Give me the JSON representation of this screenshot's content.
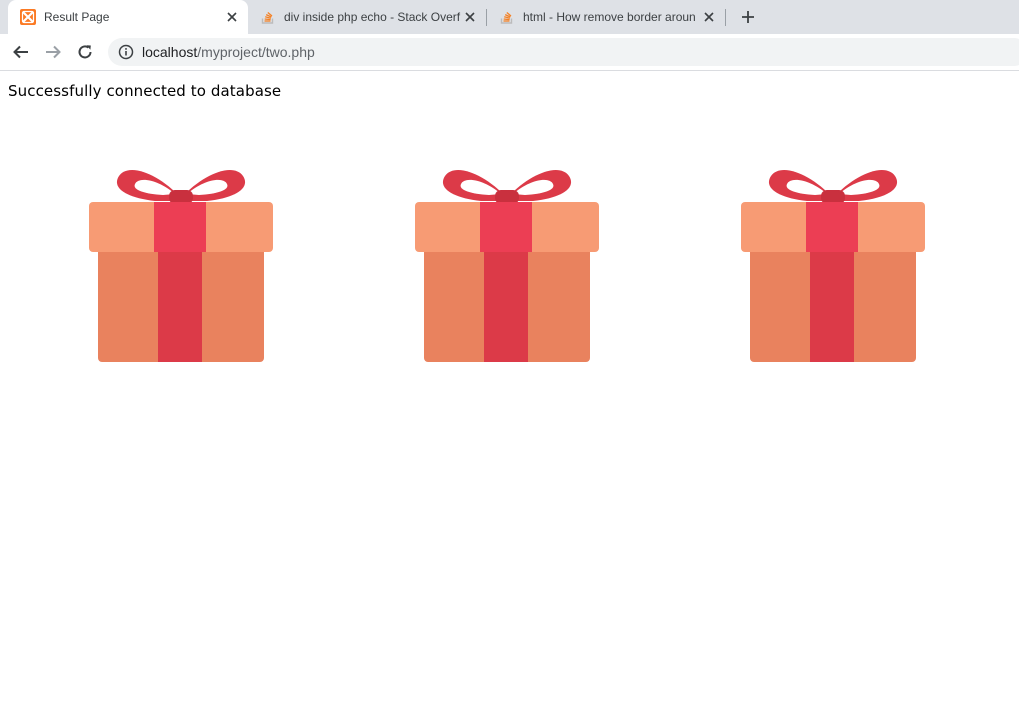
{
  "browser": {
    "tabs": [
      {
        "title": "Result Page",
        "favicon": "xampp-icon",
        "active": true
      },
      {
        "title": "div inside php echo - Stack Overf",
        "favicon": "stackoverflow-icon",
        "active": false
      },
      {
        "title": "html - How remove border aroun",
        "favicon": "stackoverflow-icon",
        "active": false
      }
    ],
    "address": {
      "host": "localhost",
      "path": "/myproject/two.php"
    }
  },
  "page": {
    "message": "Successfully connected to database",
    "gifts": [
      {
        "icon": "gift-icon"
      },
      {
        "icon": "gift-icon"
      },
      {
        "icon": "gift-icon"
      }
    ]
  },
  "colors": {
    "ribbon": "#dc3a48",
    "lid": "#f79b74",
    "box": "#e9825e",
    "tab_strip": "#dee1e6"
  }
}
